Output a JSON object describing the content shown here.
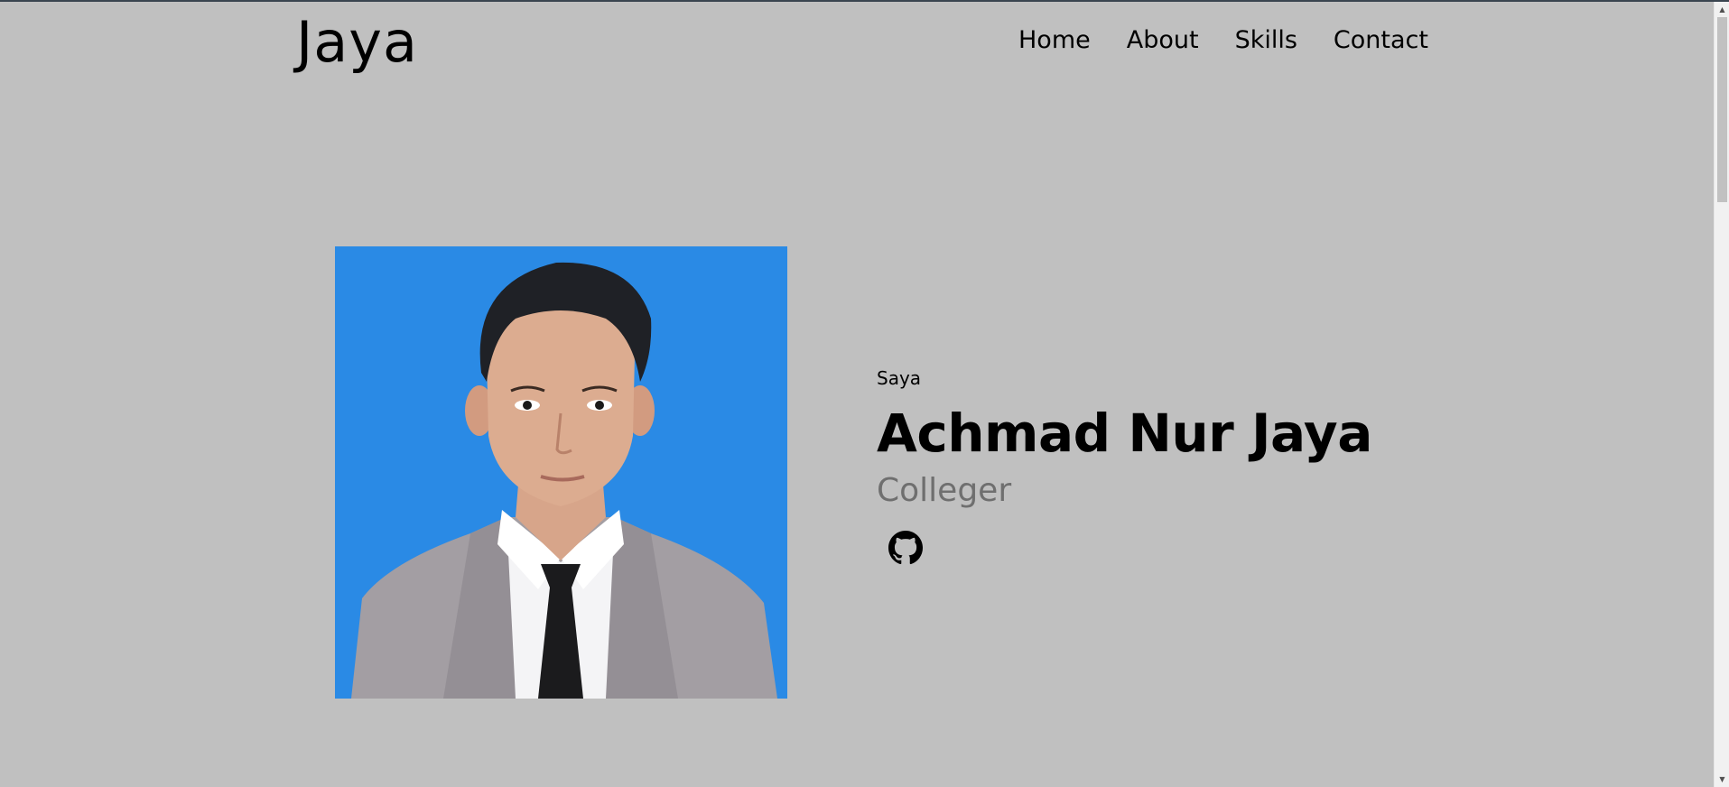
{
  "header": {
    "logo": "Jaya",
    "nav": [
      "Home",
      "About",
      "Skills",
      "Contact"
    ]
  },
  "hero": {
    "greeting": "Saya",
    "name": "Achmad Nur Jaya",
    "role": "Colleger",
    "github_icon": "github-icon",
    "photo_background": "#2a8ae5"
  },
  "colors": {
    "page_background": "#c0c0c0",
    "role_text": "#6f6f6f"
  }
}
